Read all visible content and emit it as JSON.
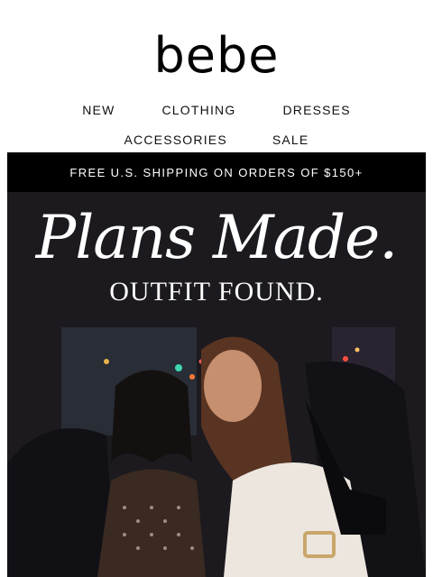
{
  "brand": {
    "logo_text": "bebe"
  },
  "nav": {
    "row1": [
      "NEW",
      "CLOTHING",
      "DRESSES"
    ],
    "row2": [
      "ACCESSORIES",
      "SALE"
    ]
  },
  "promo": {
    "text": "FREE U.S. SHIPPING ON ORDERS OF $150+"
  },
  "hero": {
    "title": "Plans Made.",
    "subtitle": "OUTFIT FOUND.",
    "image_desc_icon": "hero-photo-two-women-in-car"
  },
  "colors": {
    "bar": "#000000",
    "text_on_dark": "#ffffff"
  }
}
